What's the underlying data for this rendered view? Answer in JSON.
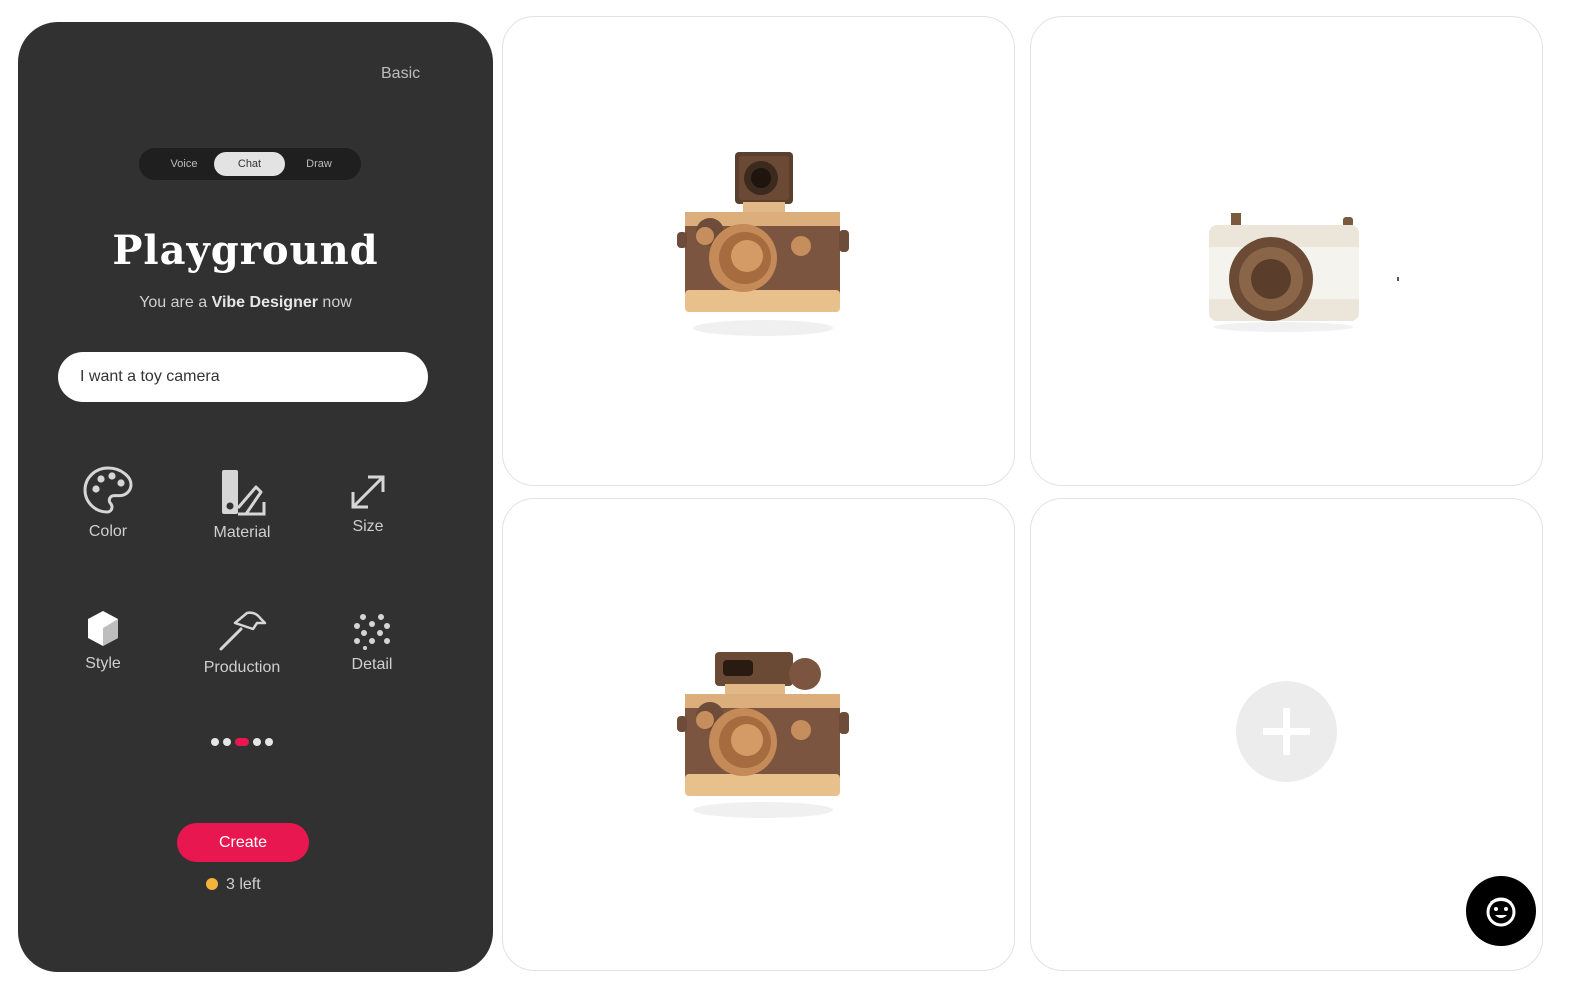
{
  "panel": {
    "mode_link": "Basic",
    "tabs": [
      {
        "label": "Voice",
        "active": false
      },
      {
        "label": "Chat",
        "active": true
      },
      {
        "label": "Draw",
        "active": false
      }
    ],
    "title": "Playground",
    "subtitle_prefix": "You are a ",
    "subtitle_bold": "Vibe Designer",
    "subtitle_suffix": " now",
    "prompt_value": "I want a toy camera",
    "options": [
      {
        "label": "Color",
        "icon": "palette-icon"
      },
      {
        "label": "Material",
        "icon": "swatch-icon"
      },
      {
        "label": "Size",
        "icon": "resize-arrow-icon"
      },
      {
        "label": "Style",
        "icon": "cube-icon"
      },
      {
        "label": "Production",
        "icon": "hammer-icon"
      },
      {
        "label": "Detail",
        "icon": "dots-grid-icon"
      }
    ],
    "pager": {
      "total": 5,
      "active_index": 2
    },
    "create_label": "Create",
    "remaining": "3 left"
  },
  "cards": [
    {
      "type": "image",
      "icon": "wooden-camera-viewfinder-image"
    },
    {
      "type": "image",
      "icon": "white-wooden-camera-image"
    },
    {
      "type": "image",
      "icon": "wooden-camera-flash-image"
    },
    {
      "type": "add",
      "icon": "plus-icon"
    }
  ],
  "colors": {
    "panel_bg": "#313131",
    "accent": "#e8174f",
    "coin": "#f2b53a"
  },
  "assistant_icon": "smiley-face-icon"
}
